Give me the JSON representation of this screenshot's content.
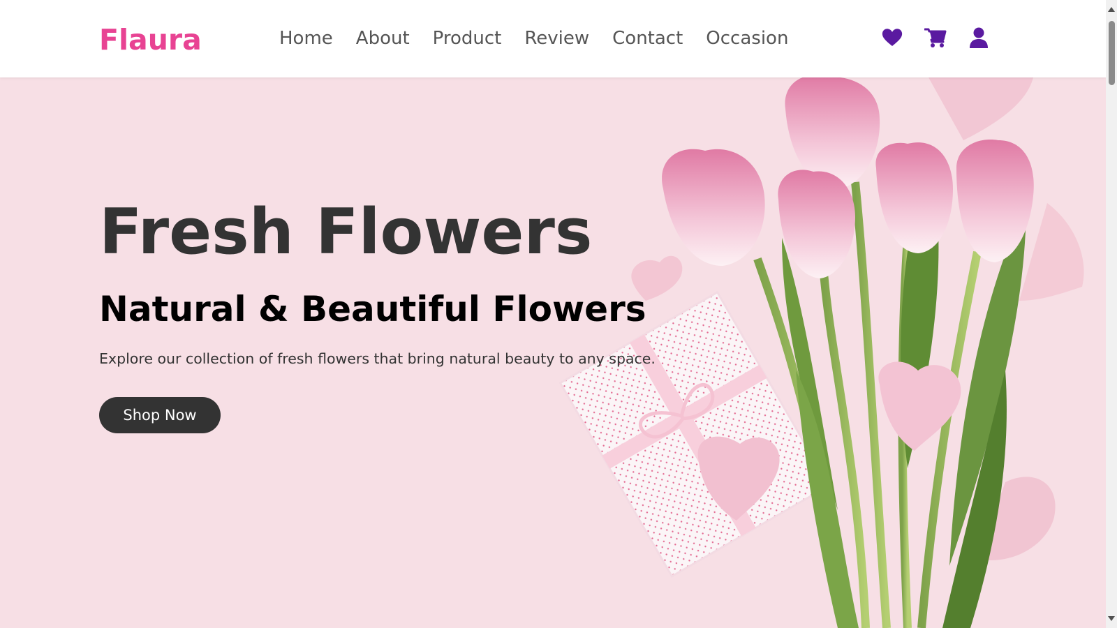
{
  "header": {
    "logo": "Flaura",
    "nav": [
      "Home",
      "About",
      "Product",
      "Review",
      "Contact",
      "Occasion"
    ],
    "icons": [
      "heart-icon",
      "cart-icon",
      "user-icon"
    ]
  },
  "hero": {
    "title": "Fresh Flowers",
    "subtitle": "Natural & Beautiful Flowers",
    "description": "Explore our collection of fresh flowers that bring natural beauty to any space.",
    "button_label": "Shop Now"
  },
  "colors": {
    "brand": "#e84393",
    "icon_accent": "#5a1aa0",
    "hero_background": "#f7dfe5",
    "button_background": "#333333"
  }
}
